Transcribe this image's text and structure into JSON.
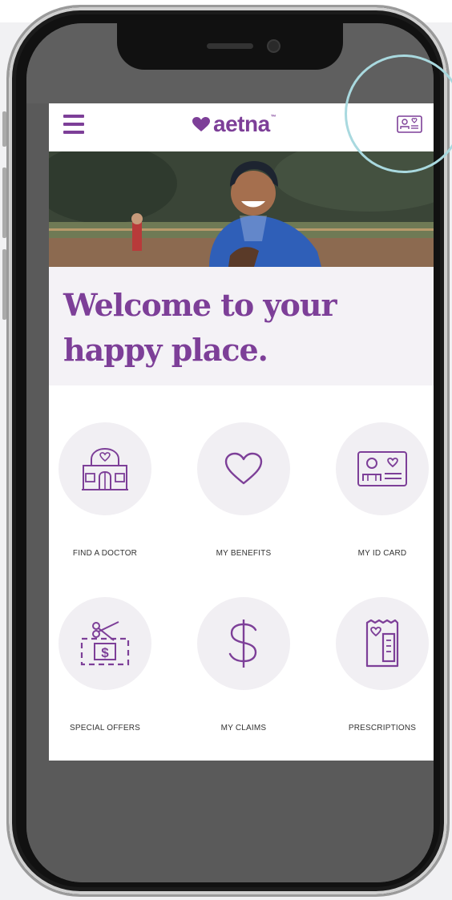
{
  "header": {
    "menu_icon": "hamburger-menu-icon",
    "logo_text": "aetna",
    "logo_tm": "™",
    "id_card_icon": "id-card-icon"
  },
  "welcome": {
    "line1": "Welcome to your",
    "line2": "happy place."
  },
  "tiles": [
    {
      "label": "FIND A DOCTOR",
      "icon": "doctor-office-icon"
    },
    {
      "label": "MY BENEFITS",
      "icon": "heart-icon"
    },
    {
      "label": "MY ID CARD",
      "icon": "id-card-icon"
    },
    {
      "label": "SPECIAL OFFERS",
      "icon": "coupon-icon"
    },
    {
      "label": "MY CLAIMS",
      "icon": "dollar-icon"
    },
    {
      "label": "PRESCRIPTIONS",
      "icon": "prescription-icon"
    }
  ],
  "colors": {
    "brand_purple": "#7d3f98",
    "tile_background": "#f1eff3",
    "highlight_ring": "#a9d9df"
  }
}
